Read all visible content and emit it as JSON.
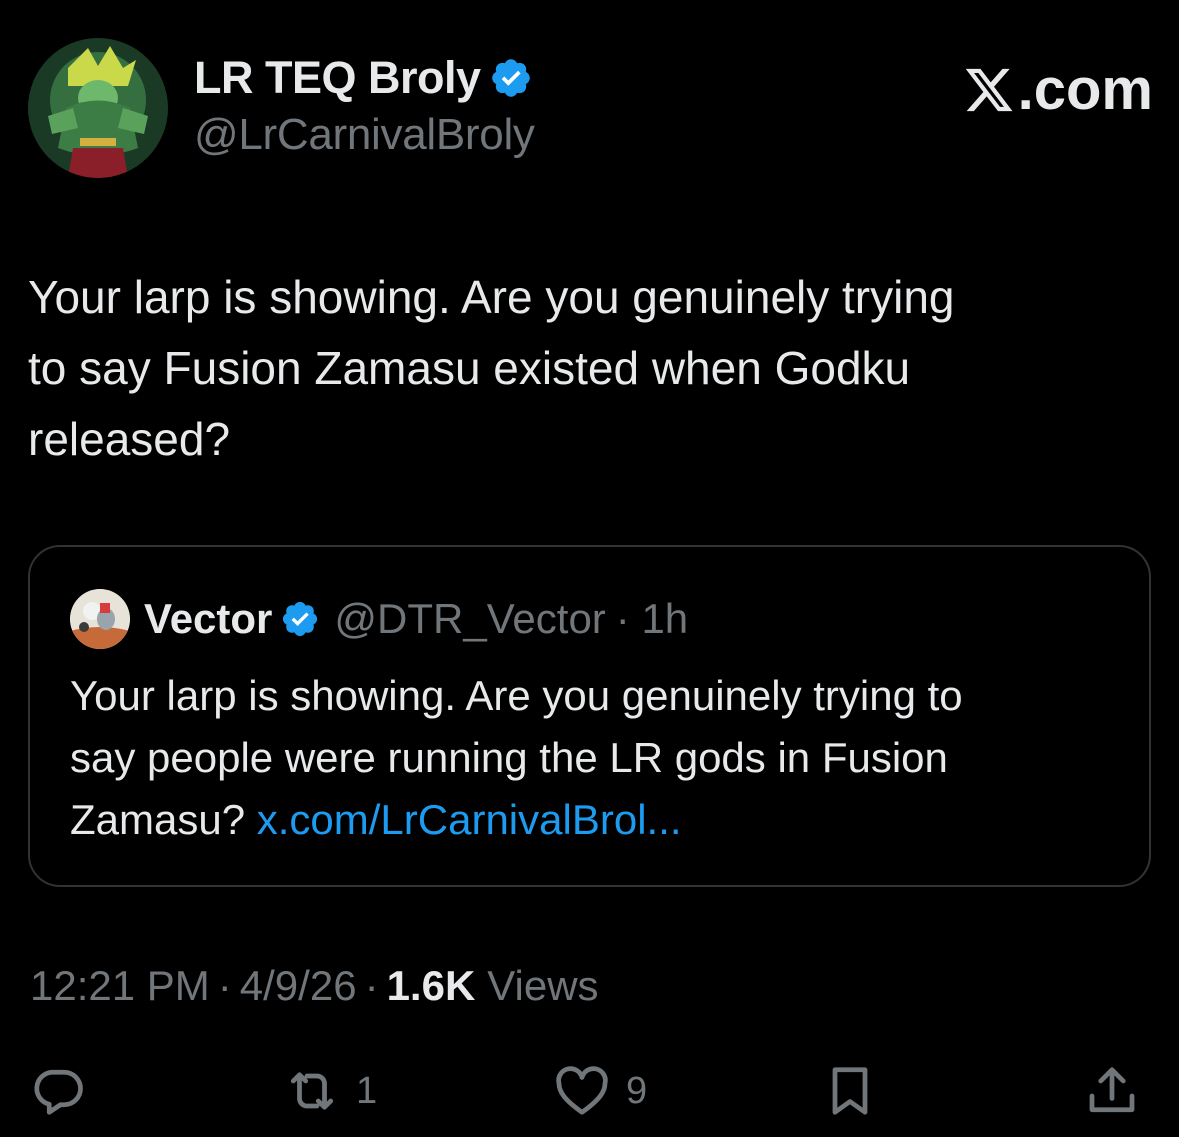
{
  "author": {
    "display_name": "LR TEQ Broly",
    "handle": "@LrCarnivalBroly",
    "verified": true
  },
  "brand": {
    "label": ".com"
  },
  "tweet": {
    "text_lines": [
      "Your larp is showing. Are you genuinely trying",
      "to say Fusion Zamasu existed when Godku",
      "released?"
    ]
  },
  "quoted": {
    "display_name": "Vector",
    "handle": "@DTR_Vector",
    "time": "· 1h",
    "text_lines": [
      "Your larp is showing. Are you genuinely trying to",
      "say people were running the LR gods in Fusion"
    ],
    "last_line_text": "Zamasu? ",
    "link_text": "x.com/LrCarnivalBrol..."
  },
  "meta": {
    "time": "12:21 PM",
    "date": "4/9/26",
    "views_count": "1.6K",
    "views_label": "Views"
  },
  "actions": {
    "reply_count": "",
    "retweet_count": "1",
    "like_count": "9"
  },
  "colors": {
    "background": "#000000",
    "text": "#e7e9ea",
    "muted": "#71767b",
    "link": "#1d9bf0",
    "verified": "#1d9bf0",
    "border": "#2f3336"
  }
}
